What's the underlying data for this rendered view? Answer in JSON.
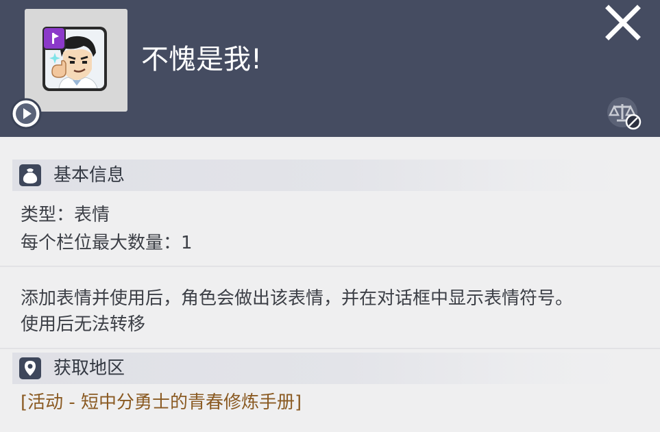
{
  "item": {
    "title": "不愧是我!"
  },
  "header": {
    "play_icon": "play-circle-icon",
    "close_icon": "close-x-icon",
    "trade_icon": "untradeable-scale-icon"
  },
  "basic_info": {
    "heading": "基本信息",
    "icon": "bag-icon",
    "type_line": "类型：表情",
    "max_slot_line": "每个栏位最大数量：1"
  },
  "description": {
    "line1": "添加表情并使用后，角色会做出该表情，并在对话框中显示表情符号。",
    "line2": "使用后无法转移"
  },
  "acquire": {
    "heading": "获取地区",
    "icon": "location-pin-icon",
    "source": "[活动 - 短中分勇士的青春修炼手册]"
  },
  "colors": {
    "header_bg": "#454c61",
    "panel_bg": "#efeff0",
    "link_brown": "#8a5a22",
    "badge_purple": "#8b39c9"
  }
}
